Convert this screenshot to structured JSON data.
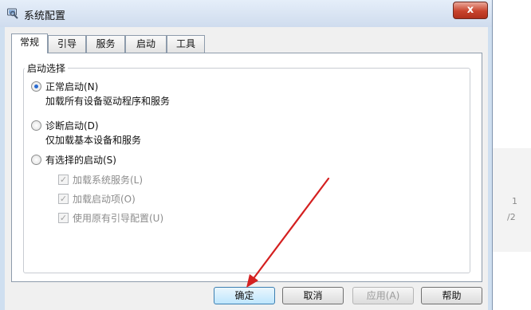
{
  "window": {
    "title": "系统配置",
    "close_label": "x"
  },
  "tabs": [
    {
      "label": "常规",
      "active": true
    },
    {
      "label": "引导",
      "active": false
    },
    {
      "label": "服务",
      "active": false
    },
    {
      "label": "启动",
      "active": false
    },
    {
      "label": "工具",
      "active": false
    }
  ],
  "startup_group": {
    "legend": "启动选择",
    "options": [
      {
        "label": "正常启动(N)",
        "description": "加载所有设备驱动程序和服务",
        "selected": true
      },
      {
        "label": "诊断启动(D)",
        "description": "仅加载基本设备和服务",
        "selected": false
      },
      {
        "label": "有选择的启动(S)",
        "selected": false
      }
    ],
    "selective_items": [
      {
        "label": "加载系统服务(L)",
        "checked": true,
        "enabled": false
      },
      {
        "label": "加载启动项(O)",
        "checked": true,
        "enabled": false
      },
      {
        "label": "使用原有引导配置(U)",
        "checked": true,
        "enabled": false
      }
    ]
  },
  "buttons": {
    "ok": "确定",
    "cancel": "取消",
    "apply": "应用(A)",
    "help": "帮助"
  },
  "side_pager": {
    "current": "1",
    "total": "/2"
  },
  "colors": {
    "annotation_arrow": "#d42020",
    "selection_accent": "#2a6bd0"
  }
}
